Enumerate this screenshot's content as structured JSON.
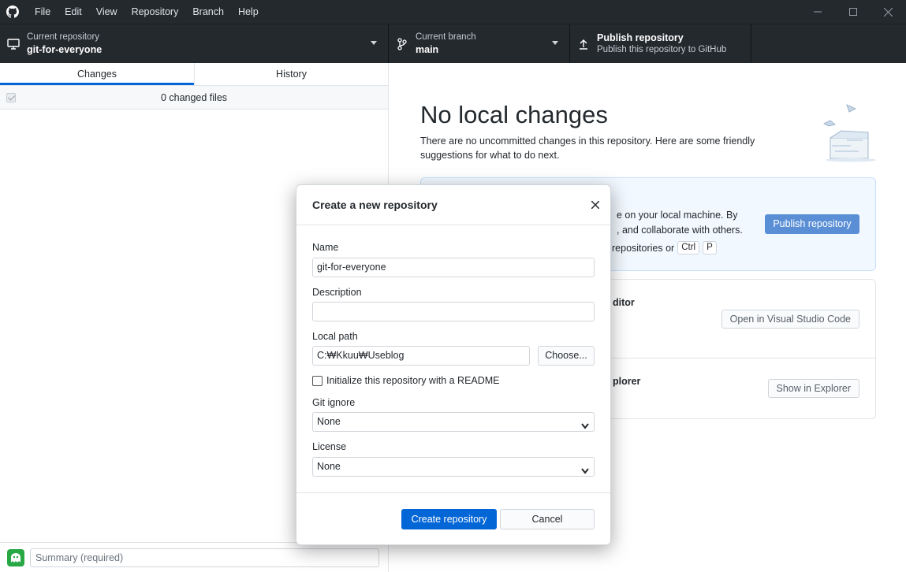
{
  "menu": [
    "File",
    "Edit",
    "View",
    "Repository",
    "Branch",
    "Help"
  ],
  "toolbar": {
    "repo_label": "Current repository",
    "repo_name": "git-for-everyone",
    "branch_label": "Current branch",
    "branch_name": "main",
    "publish_title": "Publish repository",
    "publish_sub": "Publish this repository to GitHub"
  },
  "sidebar": {
    "tab_changes": "Changes",
    "tab_history": "History",
    "changed_files": "0 changed files",
    "summary_placeholder": "Summary (required)"
  },
  "main": {
    "title": "No local changes",
    "description": "There are no uncommitted changes in this repository. Here are some friendly suggestions for what to do next.",
    "card1_line1": "e on your local machine. By",
    "card1_line2": ", and collaborate with others.",
    "card1_line3": "repositories or",
    "kbd_ctrl": "Ctrl",
    "kbd_p": "P",
    "publish_button": "Publish repository",
    "row1_title": "ditor",
    "row1_button": "Open in Visual Studio Code",
    "row2_title": "plorer",
    "row2_button": "Show in Explorer"
  },
  "dialog": {
    "title": "Create a new repository",
    "name_label": "Name",
    "name_value": "git-for-everyone",
    "description_label": "Description",
    "description_value": "",
    "path_label": "Local path",
    "path_value": "C:₩Kkuu₩Useblog",
    "choose_button": "Choose...",
    "readme_label": "Initialize this repository with a README",
    "gitignore_label": "Git ignore",
    "gitignore_value": "None",
    "license_label": "License",
    "license_value": "None",
    "create_button": "Create repository",
    "cancel_button": "Cancel"
  }
}
